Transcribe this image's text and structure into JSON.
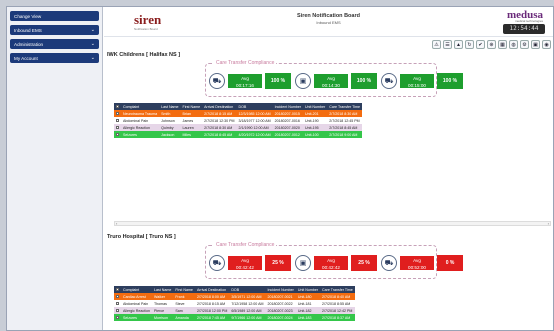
{
  "sidebar": {
    "items": [
      {
        "label": "Change View",
        "has_chevron": false
      },
      {
        "label": "Inbound EMS",
        "has_chevron": true
      },
      {
        "label": "Administration",
        "has_chevron": true
      },
      {
        "label": "My Account",
        "has_chevron": true
      }
    ]
  },
  "header": {
    "logo_left": "siren",
    "logo_left_sub": "Notification Board",
    "title": "Siren Notification Board",
    "subtitle": "Inbound EMS",
    "logo_right": "medusa",
    "logo_right_sub": "medical technologies",
    "clock": "12:54:44"
  },
  "toolbar": {
    "icons": [
      "ambulance-icon",
      "dashboard-icon",
      "warning-icon",
      "refresh-icon",
      "check-icon",
      "globe-icon",
      "table-icon",
      "cylinder-icon",
      "settings-icon",
      "save-icon",
      "camera-icon"
    ],
    "glyphs": [
      "⚠",
      "☰",
      "▲",
      "↻",
      "✔",
      "⊕",
      "▦",
      "◍",
      "⚙",
      "▣",
      "◉"
    ]
  },
  "sections": [
    {
      "title": "IWK Childrens [ Halifax NS ]",
      "compliance_label": "Care Transfer Compliance",
      "metrics": [
        {
          "icon": "car-icon",
          "glyph": "⛟",
          "avg_label": "Avg",
          "avg_value": "00:17:16",
          "pct": "100 %",
          "status": "green"
        },
        {
          "icon": "timer-icon",
          "glyph": "▣",
          "avg_label": "Avg",
          "avg_value": "00:14:30",
          "pct": "100 %",
          "status": "green"
        },
        {
          "icon": "transfer-icon",
          "glyph": "⛟",
          "avg_label": "Avg",
          "avg_value": "00:15:00",
          "pct": "100 %",
          "status": "green"
        }
      ],
      "columns": [
        "",
        "Complaint",
        "Last Name",
        "First Name",
        "Arrival Destination",
        "DOB",
        "Incident Number",
        "Unit Number",
        "Care Transfer Time"
      ],
      "rows": [
        {
          "color": "orange",
          "cells": [
            "Neurotrauma Trauma",
            "Smith",
            "Brian",
            "2/7/2018 8:15 AM",
            "12/3/1985 12:00 AM",
            "20180207-0015",
            "Unit-201",
            "2/7/2018 8:30 AM"
          ]
        },
        {
          "color": "white",
          "cells": [
            "Abdominal Pain",
            "Johnson",
            "James",
            "2/7/2018 12:30 PM",
            "3/18/1977 12:00 AM",
            "20180207-0016",
            "Unit-190",
            "2/7/2018 12:45 PM"
          ]
        },
        {
          "color": "lav",
          "cells": [
            "Allergic Reaction",
            "Quimby",
            "Lauren",
            "2/7/2018 8:30 AM",
            "2/1/1990 12:00 AM",
            "20180207-0020",
            "Unit-195",
            "2/7/2018 8:45 AM"
          ]
        },
        {
          "color": "green",
          "cells": [
            "Seizures",
            "Jackson",
            "Miles",
            "2/7/2018 8:45 AM",
            "4/20/1972 12:00 AM",
            "20180207-0012",
            "Unit-100",
            "2/7/2018 9:00 AM"
          ]
        }
      ]
    },
    {
      "title": "Truro Hospital [ Truro NS ]",
      "compliance_label": "Care Transfer Compliance",
      "metrics": [
        {
          "icon": "car-icon",
          "glyph": "⛟",
          "avg_label": "Avg",
          "avg_value": "00:42:42",
          "pct": "25 %",
          "status": "red"
        },
        {
          "icon": "timer-icon",
          "glyph": "▣",
          "avg_label": "Avg",
          "avg_value": "00:42:42",
          "pct": "25 %",
          "status": "red"
        },
        {
          "icon": "transfer-icon",
          "glyph": "⛟",
          "avg_label": "Avg",
          "avg_value": "00:52:00",
          "pct": "0 %",
          "status": "red"
        }
      ],
      "columns": [
        "",
        "Complaint",
        "Last Name",
        "First Name",
        "Arrival Destination",
        "DOB",
        "Incident Number",
        "Unit Number",
        "Care Transfer Time"
      ],
      "rows": [
        {
          "color": "orange",
          "cells": [
            "Cardiac Arrest",
            "Walker",
            "Frank",
            "2/7/2018 8:00 AM",
            "3/5/1971 12:00 AM",
            "20180207-0021",
            "Unit-180",
            "2/7/2018 8:40 AM"
          ]
        },
        {
          "color": "white",
          "cells": [
            "Abdominal Pain",
            "Thomas",
            "Steve",
            "2/7/2018 8:15 AM",
            "7/12/1958 12:00 AM",
            "20180207-0022",
            "Unit-181",
            "2/7/2018 8:55 AM"
          ]
        },
        {
          "color": "lav",
          "cells": [
            "Allergic Reaction",
            "Pierce",
            "Sam",
            "2/7/2018 12:00 PM",
            "6/5/1989 12:00 AM",
            "20180207-0023",
            "Unit-182",
            "2/7/2018 12:42 PM"
          ]
        },
        {
          "color": "green",
          "cells": [
            "Seizures",
            "Morrison",
            "Amanda",
            "2/7/2018 7:45 AM",
            "9/7/1966 12:00 AM",
            "20180207-0024",
            "Unit-183",
            "2/7/2018 8:37 AM"
          ]
        }
      ]
    }
  ]
}
